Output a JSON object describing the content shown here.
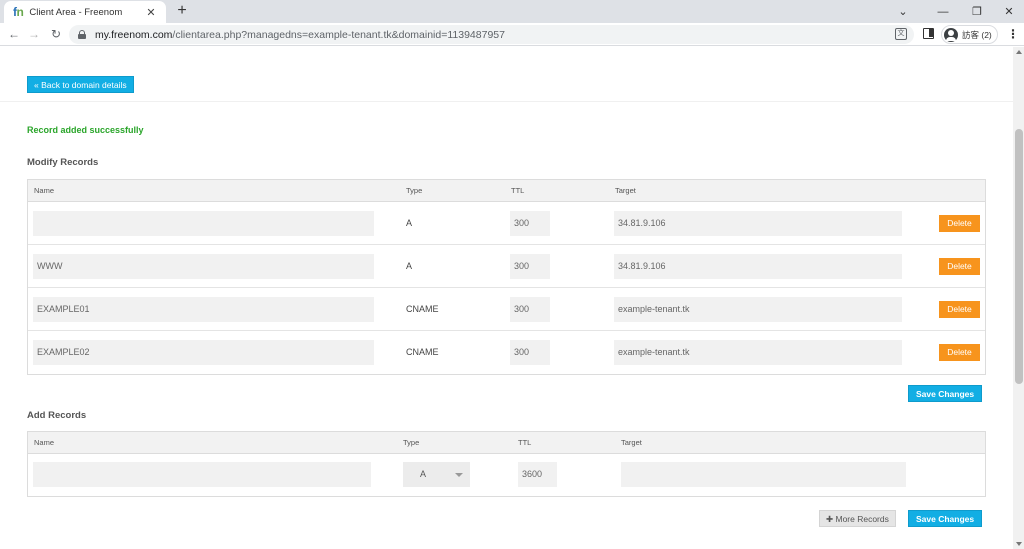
{
  "browser": {
    "tab_title": "Client Area - Freenom",
    "favicon_text": "fn",
    "url_host": "my.freenom.com",
    "url_path": "/clientarea.php?managedns=example-tenant.tk&domainid=1139487957",
    "profile_label": "訪客 (2)",
    "icons": [
      "fn-favicon",
      "close-icon",
      "plus-icon",
      "back-arrow-icon",
      "forward-arrow-icon",
      "reload-icon",
      "lock-icon",
      "translate-icon",
      "side-panel-icon",
      "avatar-icon",
      "kebab-menu-icon",
      "minimize-icon",
      "restore-icon",
      "close-window-icon",
      "tab-search-icon"
    ]
  },
  "page": {
    "back_button": "« Back to domain details",
    "success_message": "Record added successfully",
    "modify_title": "Modify Records",
    "add_title": "Add Records",
    "save_changes": "Save Changes",
    "more_records": "More Records",
    "delete_label": "Delete",
    "colors": {
      "accent": "#12aee4",
      "delete": "#f7941d",
      "success": "#2aa52a"
    }
  },
  "modify_table": {
    "headers": {
      "name": "Name",
      "type": "Type",
      "ttl": "TTL",
      "target": "Target"
    },
    "rows": [
      {
        "name": "",
        "type": "A",
        "ttl": "300",
        "target": "34.81.9.106"
      },
      {
        "name": "WWW",
        "type": "A",
        "ttl": "300",
        "target": "34.81.9.106"
      },
      {
        "name": "EXAMPLE01",
        "type": "CNAME",
        "ttl": "300",
        "target": "example-tenant.tk"
      },
      {
        "name": "EXAMPLE02",
        "type": "CNAME",
        "ttl": "300",
        "target": "example-tenant.tk"
      }
    ]
  },
  "add_table": {
    "headers": {
      "name": "Name",
      "type": "Type",
      "ttl": "TTL",
      "target": "Target"
    },
    "row": {
      "name": "",
      "type": "A",
      "ttl": "3600",
      "target": ""
    }
  }
}
